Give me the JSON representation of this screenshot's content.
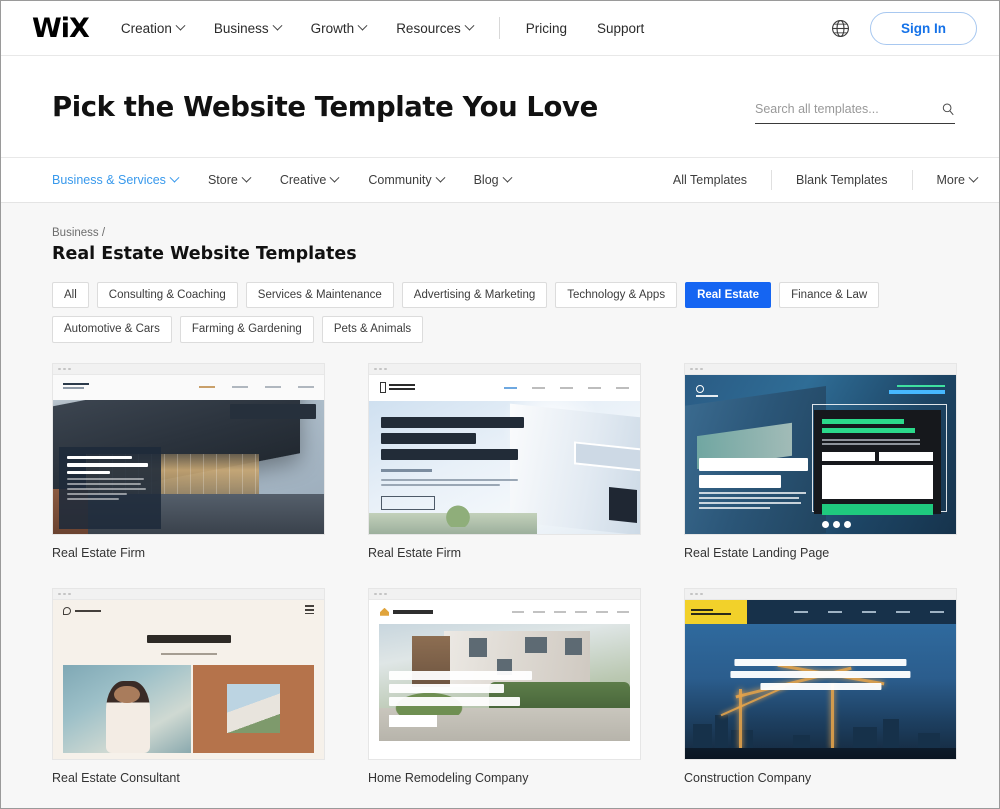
{
  "brand": {
    "logo_text": "WiX"
  },
  "topnav": {
    "links": [
      {
        "label": "Creation",
        "has_caret": true
      },
      {
        "label": "Business",
        "has_caret": true
      },
      {
        "label": "Growth",
        "has_caret": true
      },
      {
        "label": "Resources",
        "has_caret": true
      }
    ],
    "plain_links": [
      {
        "label": "Pricing"
      },
      {
        "label": "Support"
      }
    ],
    "language_icon": "globe-icon",
    "signin_label": "Sign In",
    "accent_blue": "#1572e8"
  },
  "hero": {
    "title": "Pick the Website Template You Love",
    "search": {
      "placeholder": "Search all templates...",
      "value": "",
      "icon": "search-icon"
    }
  },
  "catnav": {
    "left": [
      {
        "label": "Business & Services",
        "active": true,
        "has_caret": true
      },
      {
        "label": "Store",
        "active": false,
        "has_caret": true
      },
      {
        "label": "Creative",
        "active": false,
        "has_caret": true
      },
      {
        "label": "Community",
        "active": false,
        "has_caret": true
      },
      {
        "label": "Blog",
        "active": false,
        "has_caret": true
      }
    ],
    "right": [
      {
        "label": "All Templates",
        "has_caret": false
      },
      {
        "label": "Blank Templates",
        "has_caret": false
      },
      {
        "label": "More",
        "has_caret": true
      }
    ],
    "active_color": "#3899ec"
  },
  "content": {
    "breadcrumb": "Business /",
    "section_title": "Real Estate Website Templates",
    "active_chip_color": "#1565f2",
    "chips": [
      {
        "label": "All",
        "active": false
      },
      {
        "label": "Consulting & Coaching",
        "active": false
      },
      {
        "label": "Services & Maintenance",
        "active": false
      },
      {
        "label": "Advertising & Marketing",
        "active": false
      },
      {
        "label": "Technology & Apps",
        "active": false
      },
      {
        "label": "Real Estate",
        "active": true
      },
      {
        "label": "Finance & Law",
        "active": false
      },
      {
        "label": "Automotive & Cars",
        "active": false
      },
      {
        "label": "Farming & Gardening",
        "active": false
      },
      {
        "label": "Pets & Animals",
        "active": false
      }
    ],
    "templates": [
      {
        "label": "Real Estate Firm"
      },
      {
        "label": "Real Estate Firm"
      },
      {
        "label": "Real Estate Landing Page"
      },
      {
        "label": "Real Estate Consultant"
      },
      {
        "label": "Home Remodeling Company"
      },
      {
        "label": "Construction Company"
      }
    ]
  }
}
